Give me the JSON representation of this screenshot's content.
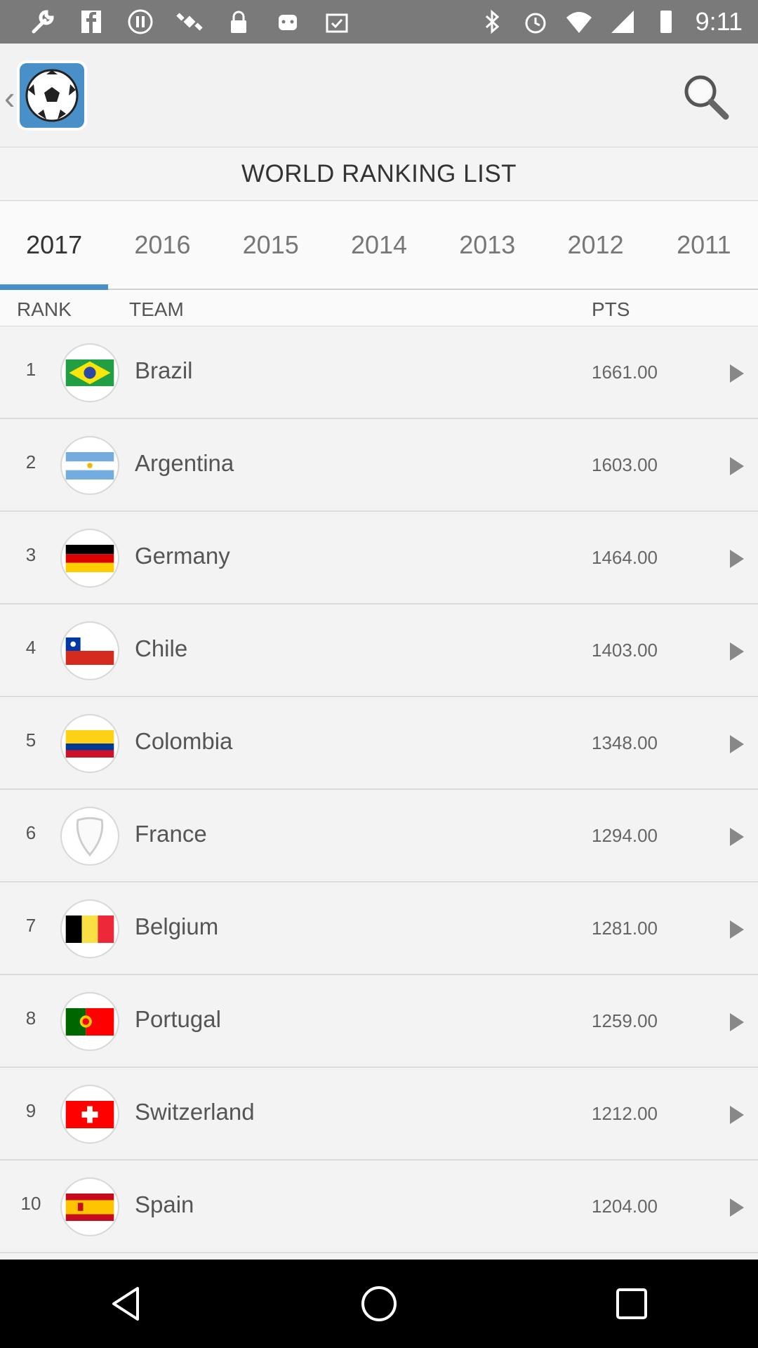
{
  "status_bar": {
    "time": "9:11",
    "left_icons": [
      "wrench-icon",
      "facebook-icon",
      "pause-icon",
      "satellite-icon",
      "lock-icon",
      "android-icon",
      "clipboard-check-icon"
    ],
    "right_icons": [
      "bluetooth-icon",
      "alarm-icon",
      "wifi-icon",
      "signal-icon",
      "battery-icon"
    ]
  },
  "app_bar": {
    "logo_icon": "soccer-ball-icon",
    "search_icon": "search-icon"
  },
  "title": "WORLD RANKING LIST",
  "year_tabs": [
    "2017",
    "2016",
    "2015",
    "2014",
    "2013",
    "2012",
    "2011"
  ],
  "active_year": "2017",
  "columns": {
    "rank": "RANK",
    "team": "TEAM",
    "pts": "PTS"
  },
  "rows": [
    {
      "rank": "1",
      "team": "Brazil",
      "pts": "1661.00"
    },
    {
      "rank": "2",
      "team": "Argentina",
      "pts": "1603.00"
    },
    {
      "rank": "3",
      "team": "Germany",
      "pts": "1464.00"
    },
    {
      "rank": "4",
      "team": "Chile",
      "pts": "1403.00"
    },
    {
      "rank": "5",
      "team": "Colombia",
      "pts": "1348.00"
    },
    {
      "rank": "6",
      "team": "France",
      "pts": "1294.00"
    },
    {
      "rank": "7",
      "team": "Belgium",
      "pts": "1281.00"
    },
    {
      "rank": "8",
      "team": "Portugal",
      "pts": "1259.00"
    },
    {
      "rank": "9",
      "team": "Switzerland",
      "pts": "1212.00"
    },
    {
      "rank": "10",
      "team": "Spain",
      "pts": "1204.00"
    }
  ],
  "colors": {
    "accent": "#4a90c8",
    "status_bar": "#7a7a7a",
    "nav_bar": "#000000"
  },
  "nav_bar": {
    "back_icon": "back-triangle-icon",
    "home_icon": "home-circle-icon",
    "recents_icon": "recents-square-icon"
  }
}
